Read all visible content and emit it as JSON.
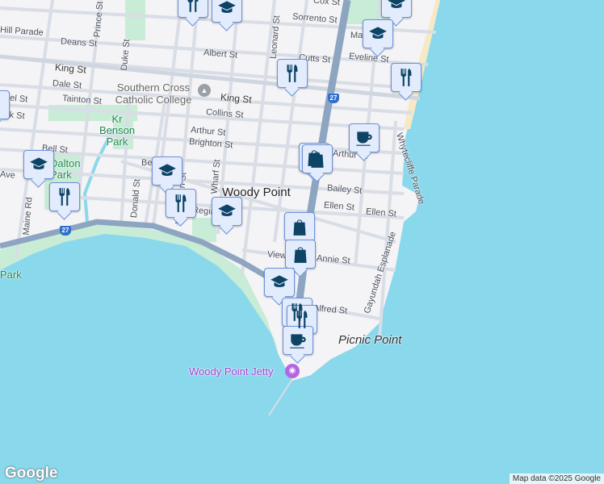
{
  "map": {
    "place_title": "Woody Point",
    "streets": [
      "Cox St",
      "Sorrento St",
      "Hill Parade",
      "Deans St",
      "Prince St",
      "Duke St",
      "Leonard St",
      "Albert St",
      "Cutts St",
      "Eveline St",
      "King St",
      "King St",
      "Dale St",
      "Tainton St",
      "Collins St",
      "Arthur St",
      "Brighton St",
      "Bell St",
      "Wharf St",
      "Donald St",
      "McLennan St",
      "Maine Rd",
      "Bailey St",
      "Ellen St",
      "Ellen St",
      "Whytecliffe Parade",
      "Gayundah Esplanade",
      "Annie St",
      "View St",
      "Alfred St",
      "Regina Ave",
      "obel St",
      "eck St",
      "Ave",
      "Be",
      "Ma",
      "Arthur St"
    ],
    "parks": [
      "Kr Benson Park",
      "Dalton Park",
      "Park"
    ],
    "poi": {
      "college": "Southern Cross Catholic College",
      "jetty": "Woody Point Jetty",
      "point": "Picnic Point"
    },
    "route_shield": "27",
    "markers": [
      {
        "type": "restaurant",
        "icon": "fork-knife-icon"
      },
      {
        "type": "shopping",
        "icon": "shopping-bag-icon"
      },
      {
        "type": "school",
        "icon": "graduation-cap-icon"
      },
      {
        "type": "cafe",
        "icon": "coffee-cup-icon"
      }
    ],
    "logo": "Google",
    "attribution": "Map data ©2025 Google"
  }
}
